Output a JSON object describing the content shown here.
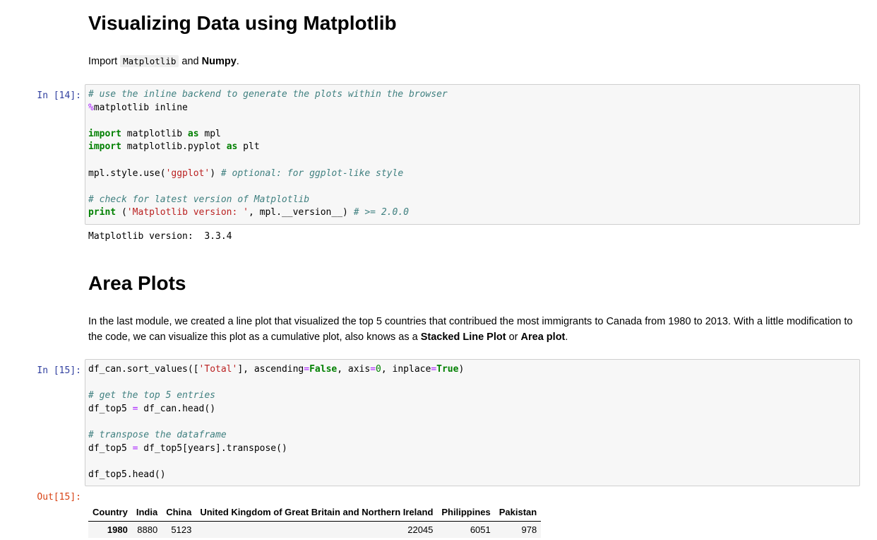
{
  "intro": {
    "title": "Visualizing Data using Matplotlib",
    "import_prefix": "Import ",
    "import_code": "Matplotlib",
    "import_and": " and ",
    "import_bold": "Numpy",
    "import_end": "."
  },
  "cell14": {
    "prompt": "In [14]:",
    "lines": {
      "l1_comment": "# use the inline backend to generate the plots within the browser",
      "l2_magic": "%",
      "l2_rest": "matplotlib inline",
      "l4_kw": "import",
      "l4_mid": " matplotlib ",
      "l4_as": "as",
      "l4_end": " mpl",
      "l5_kw": "import",
      "l5_mid": " matplotlib.pyplot ",
      "l5_as": "as",
      "l5_end": " plt",
      "l7_pre": "mpl.style.use(",
      "l7_str": "'ggplot'",
      "l7_post": ") ",
      "l7_comment": "# optional: for ggplot-like style",
      "l9_comment": "# check for latest version of Matplotlib",
      "l10_kw": "print",
      "l10_pre": " (",
      "l10_str": "'Matplotlib version: '",
      "l10_mid": ", mpl.__version__) ",
      "l10_comment": "# >= 2.0.0"
    },
    "output": "Matplotlib version:  3.3.4"
  },
  "area": {
    "title": "Area Plots",
    "para_text": "In the last module, we created a line plot that visualized the top 5 countries that contribued the most immigrants to Canada from 1980 to 2013. With a little modification to the code, we can visualize this plot as a cumulative plot, also knows as a ",
    "bold1": "Stacked Line Plot",
    "or": " or ",
    "bold2": "Area plot",
    "end": "."
  },
  "cell15": {
    "prompt": "In [15]:",
    "lines": {
      "l1_pre": "df_can.sort_values([",
      "l1_str": "'Total'",
      "l1_mid1": "], ascending",
      "l1_eq1": "=",
      "l1_false": "False",
      "l1_mid2": ", axis",
      "l1_eq2": "=",
      "l1_zero": "0",
      "l1_mid3": ", inplace",
      "l1_eq3": "=",
      "l1_true": "True",
      "l1_end": ")",
      "l3_comment": "# get the top 5 entries",
      "l4_pre": "df_top5 ",
      "l4_eq": "=",
      "l4_post": " df_can.head()",
      "l6_comment": "# transpose the dataframe",
      "l7_pre": "df_top5 ",
      "l7_eq": "=",
      "l7_post": " df_top5[years].transpose()",
      "l9": "df_top5.head()"
    },
    "out_prompt": "Out[15]:",
    "table": {
      "headers": [
        "Country",
        "India",
        "China",
        "United Kingdom of Great Britain and Northern Ireland",
        "Philippines",
        "Pakistan"
      ],
      "rows": [
        {
          "index": "1980",
          "values": [
            "8880",
            "5123",
            "22045",
            "6051",
            "978"
          ]
        }
      ]
    }
  }
}
